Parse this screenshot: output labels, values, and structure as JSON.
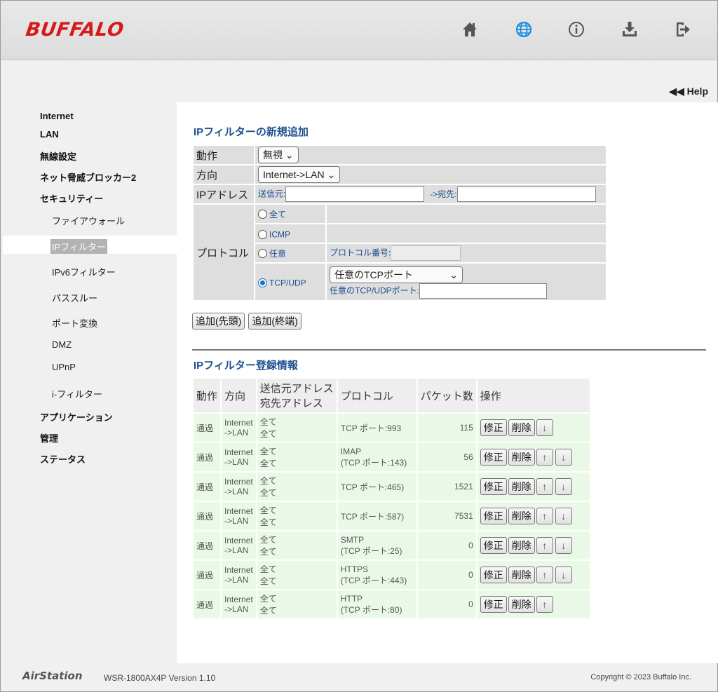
{
  "header": {
    "logo": "BUFFALO",
    "icons": [
      "home-icon",
      "globe-icon",
      "info-icon",
      "download-icon",
      "logout-icon"
    ],
    "accent_color": "#1a8fe0"
  },
  "help_label": "Help",
  "sidebar": {
    "items": [
      {
        "label": "Internet"
      },
      {
        "label": "LAN"
      },
      {
        "label": "無線設定"
      },
      {
        "label": "ネット脅威ブロッカー2"
      },
      {
        "label": "セキュリティー"
      }
    ],
    "sub_items": [
      {
        "label": "ファイアウォール"
      },
      {
        "label": "IPフィルター"
      },
      {
        "label": "IPv6フィルター"
      },
      {
        "label": "パススルー"
      },
      {
        "label": "ポート変換"
      },
      {
        "label": "DMZ"
      },
      {
        "label": "UPnP"
      },
      {
        "label": "i-フィルター"
      }
    ],
    "bottom_items": [
      {
        "label": "アプリケーション"
      },
      {
        "label": "管理"
      },
      {
        "label": "ステータス"
      }
    ]
  },
  "add_form": {
    "title": "IPフィルターの新規追加",
    "action_label": "動作",
    "action_value": "無視",
    "direction_label": "方向",
    "direction_value": "Internet->LAN",
    "ip_label": "IPアドレス",
    "src_label": "送信元:",
    "src_value": "",
    "dst_label": "->宛先:",
    "dst_value": "",
    "protocol_label": "プロトコル",
    "proto_all": "全て",
    "proto_icmp": "ICMP",
    "proto_any": "任意",
    "proto_number_label": "プロトコル番号:",
    "proto_number_value": "",
    "proto_tcpudp": "TCP/UDP",
    "tcp_port_select": "任意のTCPポート",
    "tcpudp_port_label": "任意のTCP/UDPポート:",
    "tcpudp_port_value": "",
    "selected_protocol": "TCP/UDP",
    "add_first_label": "追加(先頭)",
    "add_last_label": "追加(終端)"
  },
  "list": {
    "title": "IPフィルター登録情報",
    "headers": {
      "action": "動作",
      "direction": "方向",
      "src": "送信元アドレス",
      "dst": "宛先アドレス",
      "protocol": "プロトコル",
      "packets": "パケット数",
      "ops": "操作"
    },
    "edit_label": "修正",
    "delete_label": "削除",
    "up_label": "↑",
    "down_label": "↓",
    "rows": [
      {
        "action": "通過",
        "dir1": "Internet",
        "dir2": "->LAN",
        "src": "全て",
        "dst": "全て",
        "proto1": "TCP ポート:993",
        "proto2": "",
        "packets": "115"
      },
      {
        "action": "通過",
        "dir1": "Internet",
        "dir2": "->LAN",
        "src": "全て",
        "dst": "全て",
        "proto1": "IMAP",
        "proto2": "(TCP ポート:143)",
        "packets": "56"
      },
      {
        "action": "通過",
        "dir1": "Internet",
        "dir2": "->LAN",
        "src": "全て",
        "dst": "全て",
        "proto1": "TCP ポート:465)",
        "proto2": "",
        "packets": "1521"
      },
      {
        "action": "通過",
        "dir1": "Internet",
        "dir2": "->LAN",
        "src": "全て",
        "dst": "全て",
        "proto1": "TCP ポート:587)",
        "proto2": "",
        "packets": "7531"
      },
      {
        "action": "通過",
        "dir1": "Internet",
        "dir2": "->LAN",
        "src": "全て",
        "dst": "全て",
        "proto1": "SMTP",
        "proto2": "(TCP ポート:25)",
        "packets": "0"
      },
      {
        "action": "通過",
        "dir1": "Internet",
        "dir2": "->LAN",
        "src": "全て",
        "dst": "全て",
        "proto1": "HTTPS",
        "proto2": "(TCP ポート:443)",
        "packets": "0"
      },
      {
        "action": "通過",
        "dir1": "Internet",
        "dir2": "->LAN",
        "src": "全て",
        "dst": "全て",
        "proto1": "HTTP",
        "proto2": "(TCP ポート:80)",
        "packets": "0"
      }
    ]
  },
  "footer": {
    "brand": "AirStation",
    "version": "WSR-1800AX4P Version 1.10",
    "copyright": "Copyright © 2023 Buffalo Inc."
  }
}
